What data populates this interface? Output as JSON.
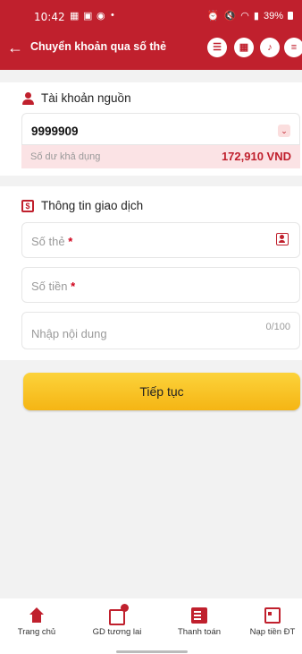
{
  "status_bar": {
    "time": "10:42",
    "battery": "39%"
  },
  "header": {
    "title": "Chuyển khoản qua số thẻ"
  },
  "source_account": {
    "section_title": "Tài khoản nguồn",
    "account_number": "9999909",
    "balance_label": "Số dư khả dụng",
    "balance_value": "172,910 VND"
  },
  "transaction": {
    "section_title": "Thông tin giao dịch",
    "card_number_label": "Số thẻ",
    "amount_label": "Số tiền",
    "required_mark": "*",
    "content_placeholder": "Nhập nội dung",
    "content_counter": "0/100"
  },
  "continue_button": "Tiếp tục",
  "bottom_nav": [
    {
      "label": "Trang chủ",
      "icon": "home-icon"
    },
    {
      "label": "GD tương lai",
      "icon": "future-transaction-icon"
    },
    {
      "label": "Thanh toán",
      "icon": "payment-icon"
    },
    {
      "label": "Nạp tiền ĐT",
      "icon": "phone-topup-icon"
    }
  ],
  "colors": {
    "brand": "#c0202d",
    "button": "#f5b514",
    "balance_bg": "#fbe3e5"
  }
}
